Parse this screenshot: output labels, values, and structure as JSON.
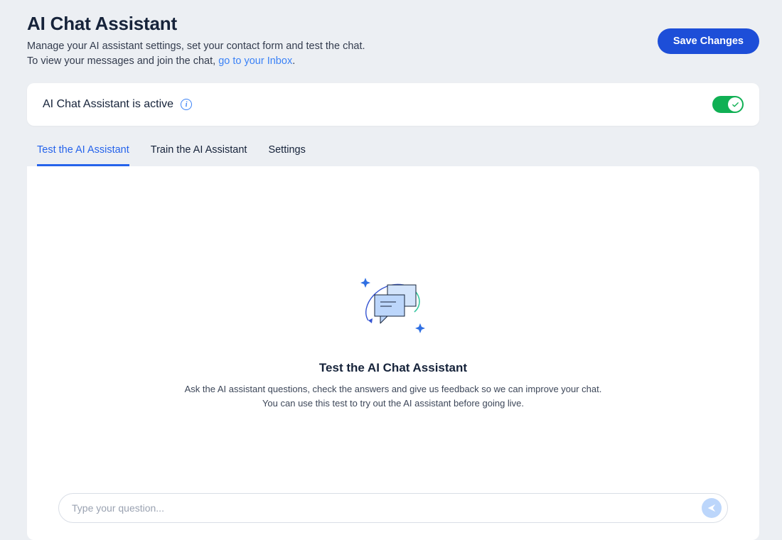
{
  "header": {
    "title": "AI Chat Assistant",
    "sub_line1": "Manage your AI assistant settings, set your contact form and test the chat.",
    "sub_line2_prefix": "To view your messages and join the chat, ",
    "inbox_link_text": "go to your Inbox",
    "sub_line2_suffix": ".",
    "save_label": "Save Changes"
  },
  "active_card": {
    "label": "AI Chat Assistant is active",
    "info_icon": "info-icon",
    "toggle_on": true,
    "toggle_color": "#10b054"
  },
  "tabs": [
    {
      "id": "test",
      "label": "Test the AI Assistant",
      "active": true
    },
    {
      "id": "train",
      "label": "Train the AI Assistant",
      "active": false
    },
    {
      "id": "settings",
      "label": "Settings",
      "active": false
    }
  ],
  "test_panel": {
    "heading": "Test the AI Chat Assistant",
    "desc_line1": "Ask the AI assistant questions, check the answers and give us feedback so we can improve your chat.",
    "desc_line2": "You can use this test to try out the AI assistant before going live."
  },
  "input": {
    "placeholder": "Type your question...",
    "value": "",
    "send_icon": "send-icon"
  },
  "colors": {
    "accent": "#2563eb",
    "accent_dark": "#1d4ed8",
    "toggle_green": "#10b054",
    "bg": "#eceff3"
  }
}
